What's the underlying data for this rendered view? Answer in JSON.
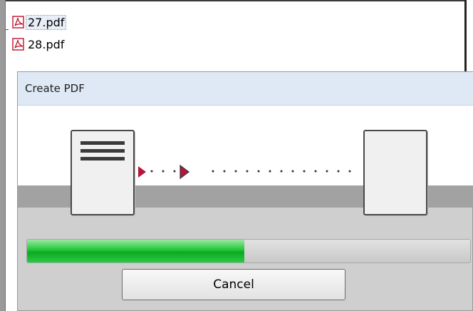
{
  "file_list": {
    "items": [
      {
        "name": "27.pdf",
        "icon": "pdf-file-icon",
        "selected": true
      },
      {
        "name": "28.pdf",
        "icon": "pdf-file-icon",
        "selected": false
      }
    ]
  },
  "dialog": {
    "title": "Create PDF",
    "progress_fraction": 0.49,
    "cancel_label": "Cancel"
  },
  "colors": {
    "pdf_red": "#c0102c",
    "arrow_red": "#b5163a",
    "progress_green": "#1fc736"
  }
}
